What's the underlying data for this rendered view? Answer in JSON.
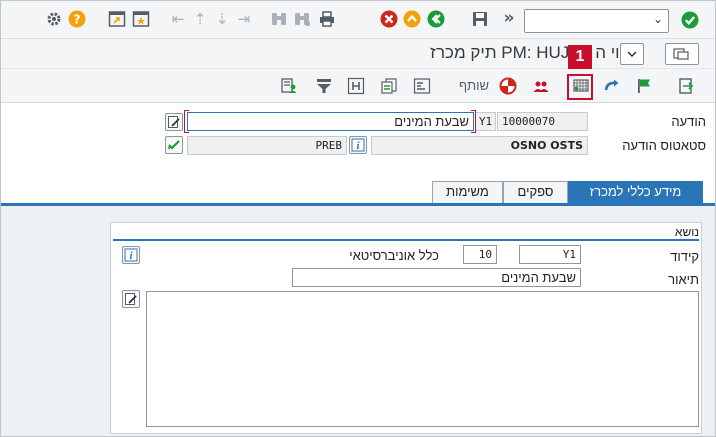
{
  "title_bar": {
    "title": "שינוי ה     ת PM: HUJI תיק מכרז"
  },
  "command_field": {
    "value": ""
  },
  "callout": {
    "number": "1"
  },
  "toolbar2": {
    "partner_label": "שותף"
  },
  "form": {
    "notification": {
      "label": "הודעה",
      "number": "10000070",
      "type": "Y1",
      "description": "שבעת המינים"
    },
    "status": {
      "label": "סטאטוס הודעה",
      "system_status": "OSNO OSTS",
      "user_status": "PREB"
    }
  },
  "tabs": [
    {
      "label": "מידע כללי למכרז",
      "active": true
    },
    {
      "label": "ספקים",
      "active": false
    },
    {
      "label": "משימות",
      "active": false
    }
  ],
  "subject": {
    "header": "נושא",
    "code_label": "קידוד",
    "code_group": "Y1",
    "code": "10",
    "code_text": "כלל אוניברסיטאי",
    "description_label": "תיאור",
    "description_value": "שבעת המינים",
    "long_text": ""
  },
  "colors": {
    "accent": "#2a74b8",
    "highlight": "#c8102e",
    "enter": "#1c9b3a",
    "cancel": "#d0271d",
    "orange": "#f0a30a"
  }
}
